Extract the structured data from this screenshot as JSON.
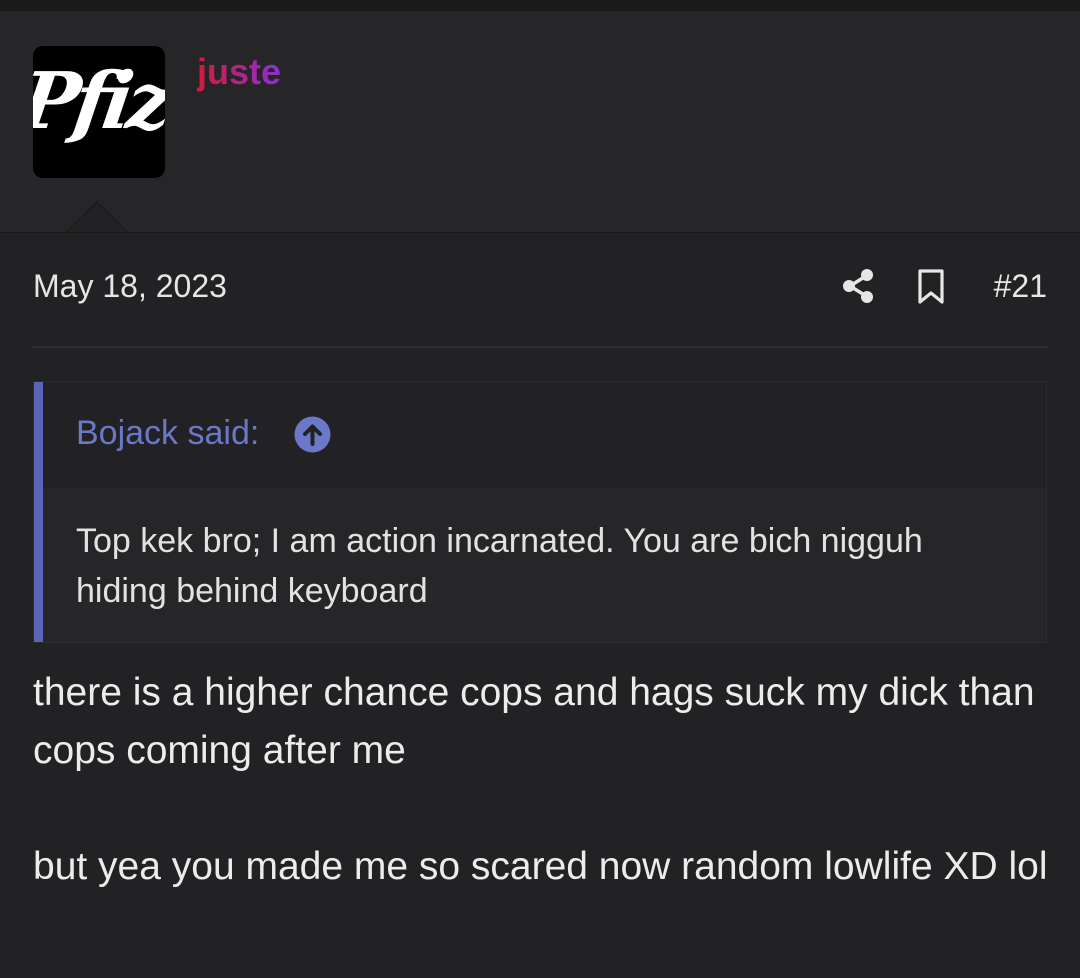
{
  "user": {
    "name": "juste",
    "avatar_text": "Pfizer"
  },
  "post": {
    "date": "May 18, 2023",
    "number": "#21",
    "paragraphs": [
      "there is a higher chance cops and hags suck my dick than cops coming after me",
      "but yea you made me so scared now random lowlife XD lol"
    ]
  },
  "quote": {
    "author": "Bojack said:",
    "text": "Top kek bro; I am action incarnated. You are bich nigguh hiding behind keyboard"
  },
  "icons": {
    "share": "share-icon",
    "bookmark": "bookmark-icon",
    "quote_jump": "arrow-circle-up-icon"
  },
  "colors": {
    "background": "#222224",
    "header_background": "#262628",
    "username_gradient_start": "#d6193b",
    "username_gradient_end": "#8b2fd6",
    "quote_accent": "#5a64b8",
    "quote_author": "#6b77c9",
    "text": "#e6e6e6"
  }
}
